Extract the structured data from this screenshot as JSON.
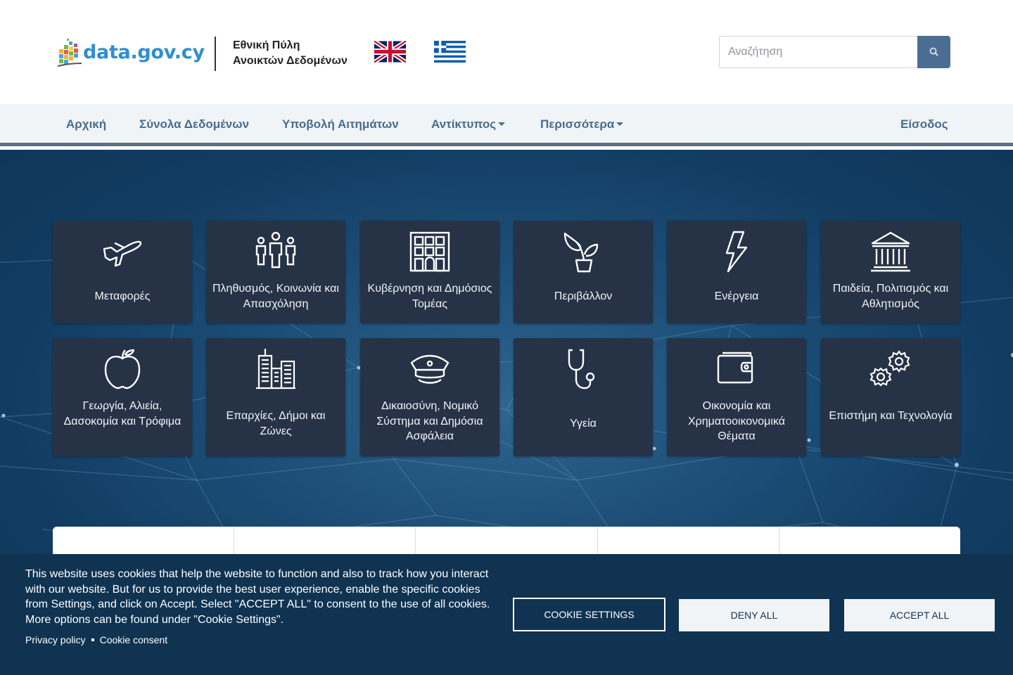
{
  "header": {
    "logo_text": "data.gov.cy",
    "portal_title_line1": "Εθνική Πύλη",
    "portal_title_line2": "Ανοικτών Δεδομένων",
    "search_placeholder": "Αναζήτηση"
  },
  "nav": {
    "items": [
      {
        "label": "Αρχική"
      },
      {
        "label": "Σύνολα Δεδομένων"
      },
      {
        "label": "Υποβολή Αιτημάτων"
      },
      {
        "label": "Αντίκτυπος",
        "dropdown": true
      },
      {
        "label": "Περισσότερα",
        "dropdown": true
      }
    ],
    "login": "Είσοδος"
  },
  "categories": [
    {
      "label": "Μεταφορές",
      "icon": "airplane-icon"
    },
    {
      "label": "Πληθυσμός, Κοινωνία και Απασχόληση",
      "icon": "people-icon"
    },
    {
      "label": "Κυβέρνηση και Δημόσιος Τομέας",
      "icon": "government-building-icon"
    },
    {
      "label": "Περιβάλλον",
      "icon": "plant-icon"
    },
    {
      "label": "Ενέργεια",
      "icon": "lightning-icon"
    },
    {
      "label": "Παιδεία, Πολιτισμός και Αθλητισμός",
      "icon": "museum-icon"
    },
    {
      "label": "Γεωργία, Αλιεία, Δασοκομία και Τρόφιμα",
      "icon": "apple-icon"
    },
    {
      "label": "Επαρχίες, Δήμοι και Ζώνες",
      "icon": "city-icon"
    },
    {
      "label": "Δικαιοσύνη, Νομικό Σύστημα και Δημόσια Ασφάλεια",
      "icon": "police-cap-icon"
    },
    {
      "label": "Υγεία",
      "icon": "stethoscope-icon"
    },
    {
      "label": "Οικονομία και Χρηματοοικονομικά Θέματα",
      "icon": "wallet-icon"
    },
    {
      "label": "Επιστήμη και Τεχνολογία",
      "icon": "gears-icon"
    }
  ],
  "cookie_banner": {
    "text": "This website uses cookies that help the website to function and also to track how you interact with our website. But for us to provide the best user experience, enable the specific cookies from Settings, and click on Accept. Select \"ACCEPT ALL\" to consent to the use of all cookies. More options can be found under \"Cookie Settings\".",
    "privacy_link": "Privacy policy",
    "consent_link": "Cookie consent",
    "settings_button": "COOKIE SETTINGS",
    "deny_button": "DENY ALL",
    "accept_button": "ACCEPT ALL"
  },
  "colors": {
    "nav_text": "#456d8f",
    "hero_bg": "#123c62",
    "tile_bg": "#263246",
    "cookie_bg": "#0f3351",
    "logo_blue": "#2f8fcf"
  }
}
